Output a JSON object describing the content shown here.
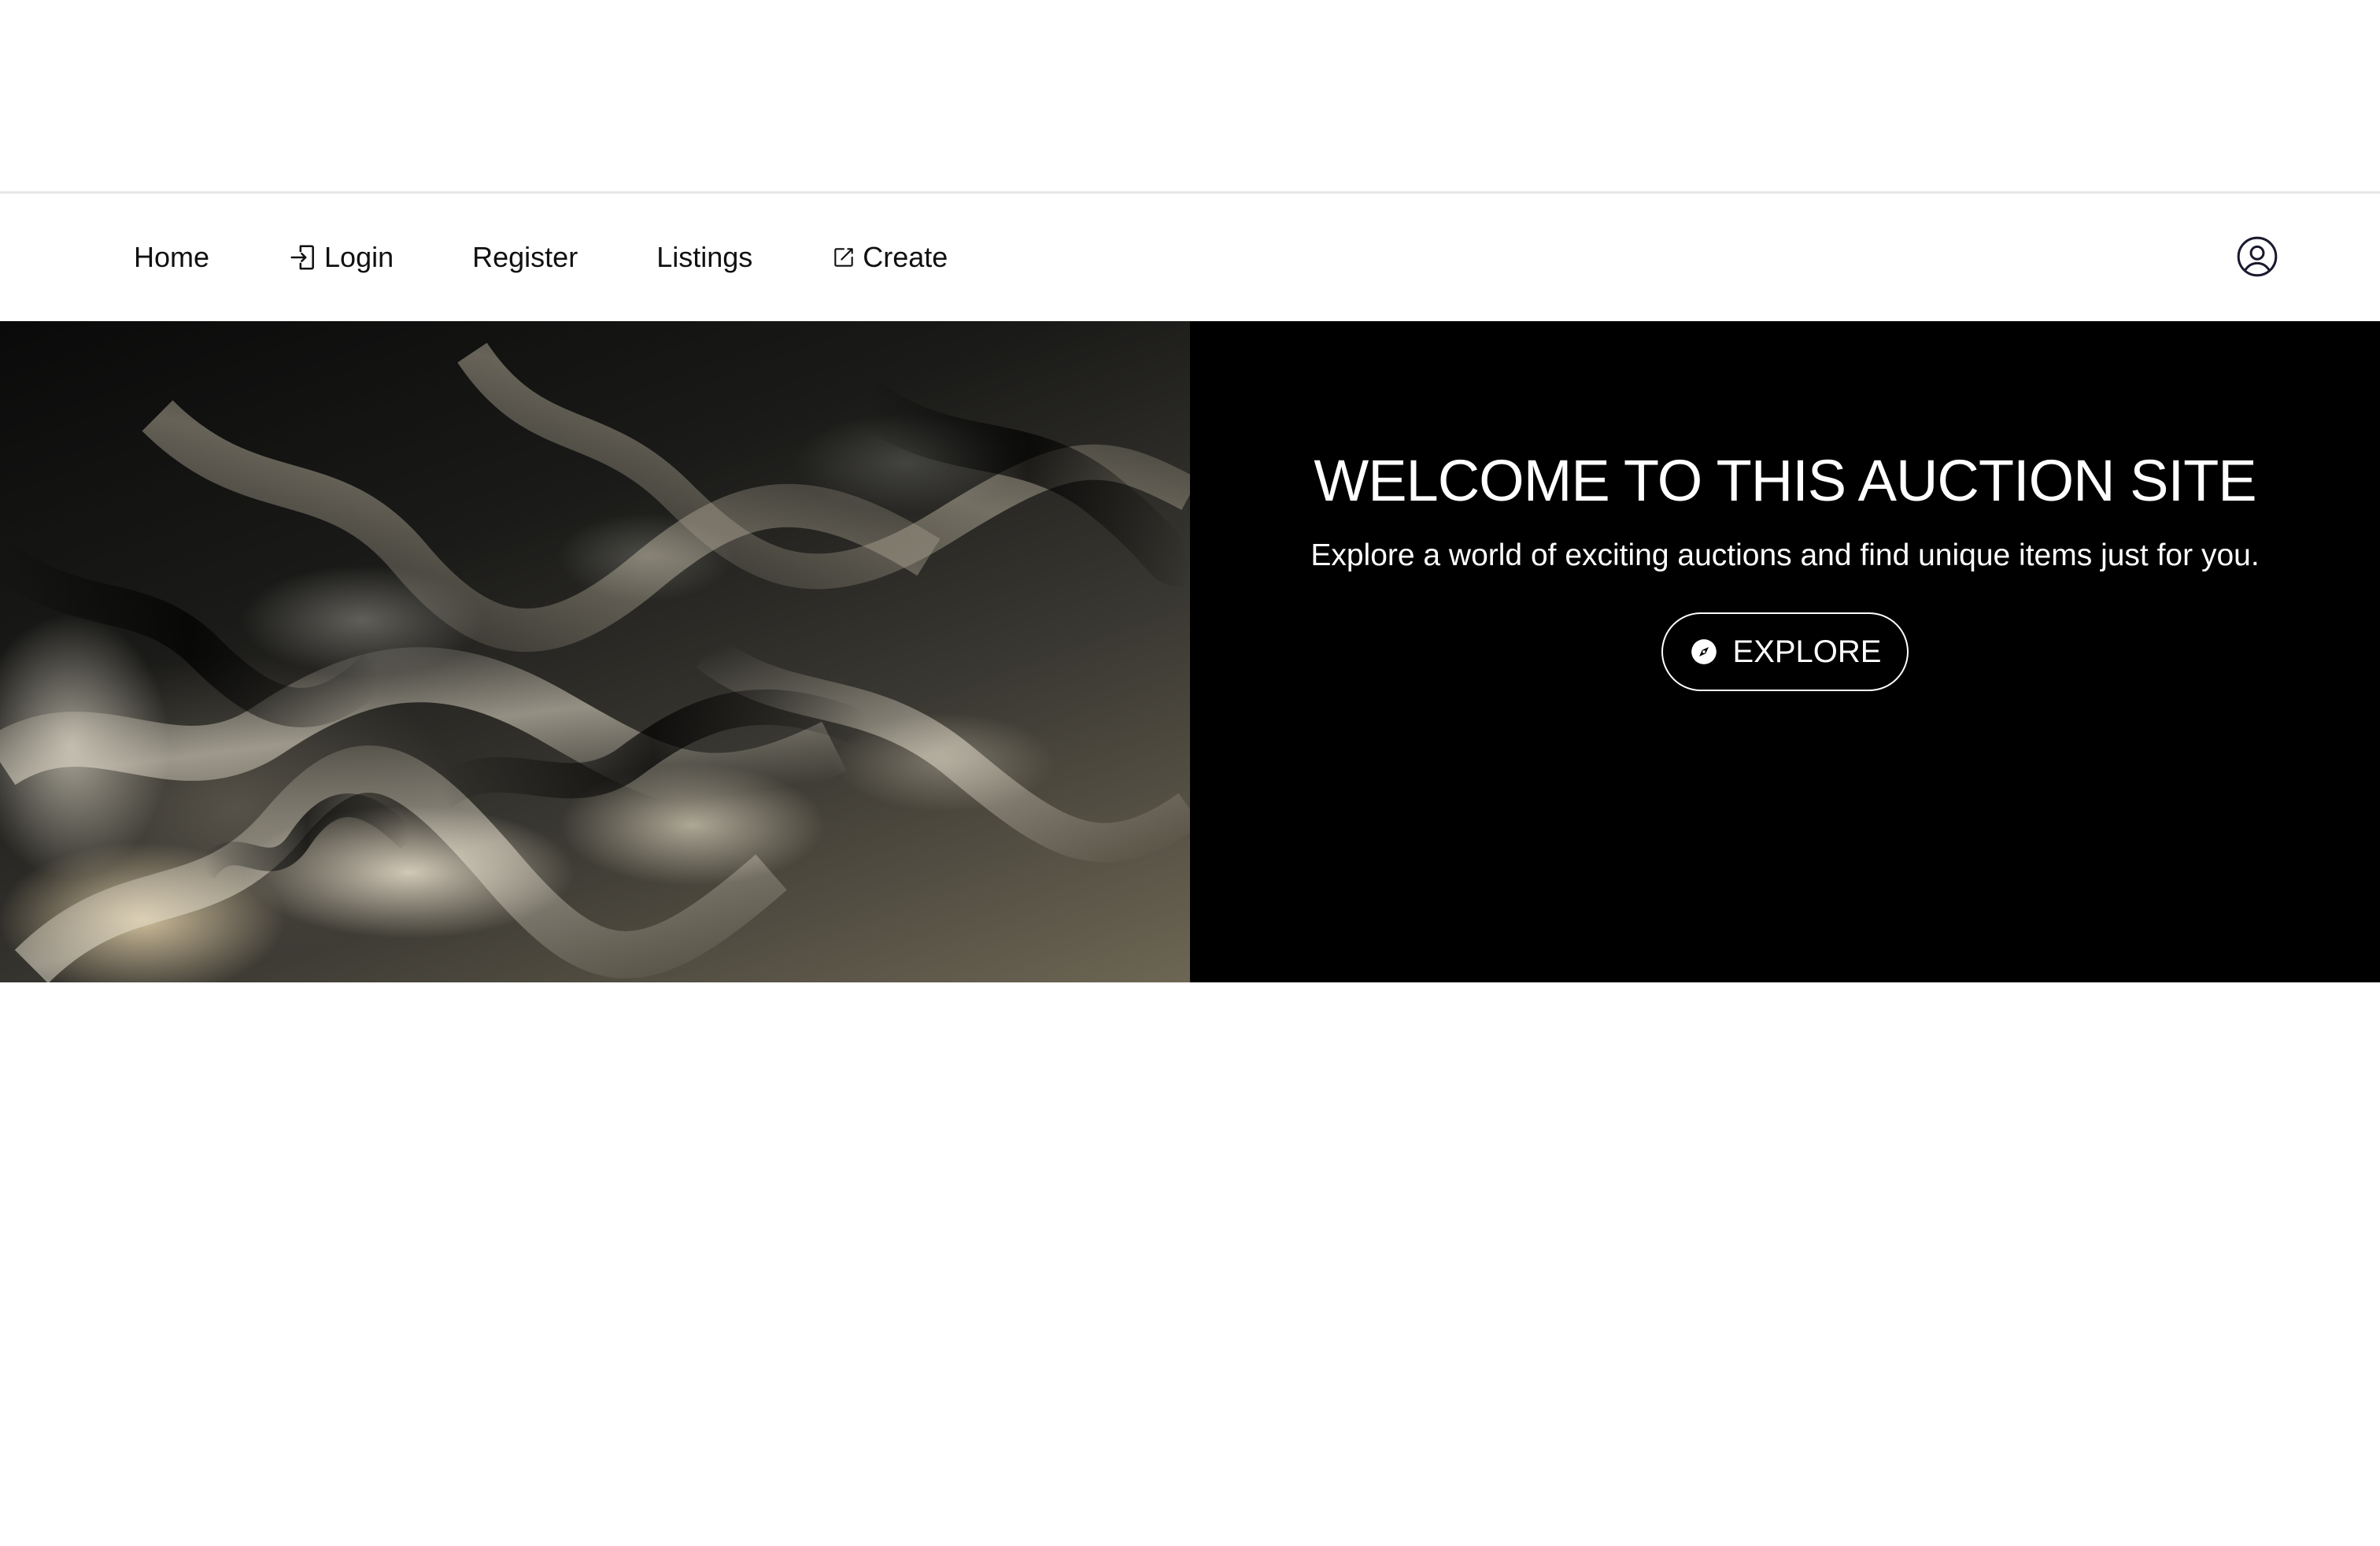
{
  "nav": {
    "items": [
      {
        "label": "Home",
        "icon": ""
      },
      {
        "label": "Login",
        "icon": "login-icon"
      },
      {
        "label": "Register",
        "icon": ""
      },
      {
        "label": "Listings",
        "icon": ""
      },
      {
        "label": "Create",
        "icon": "edit-icon"
      }
    ],
    "profile_icon": "user-circle-icon"
  },
  "hero": {
    "title": "WELCOME TO THIS AUCTION SITE",
    "subtitle": "Explore a world of exciting auctions and find unique items just for you.",
    "button_label": "EXPLORE",
    "button_icon": "compass-icon"
  },
  "colors": {
    "hero_background": "#000000",
    "text_dark": "#111111",
    "text_light": "#ffffff"
  }
}
